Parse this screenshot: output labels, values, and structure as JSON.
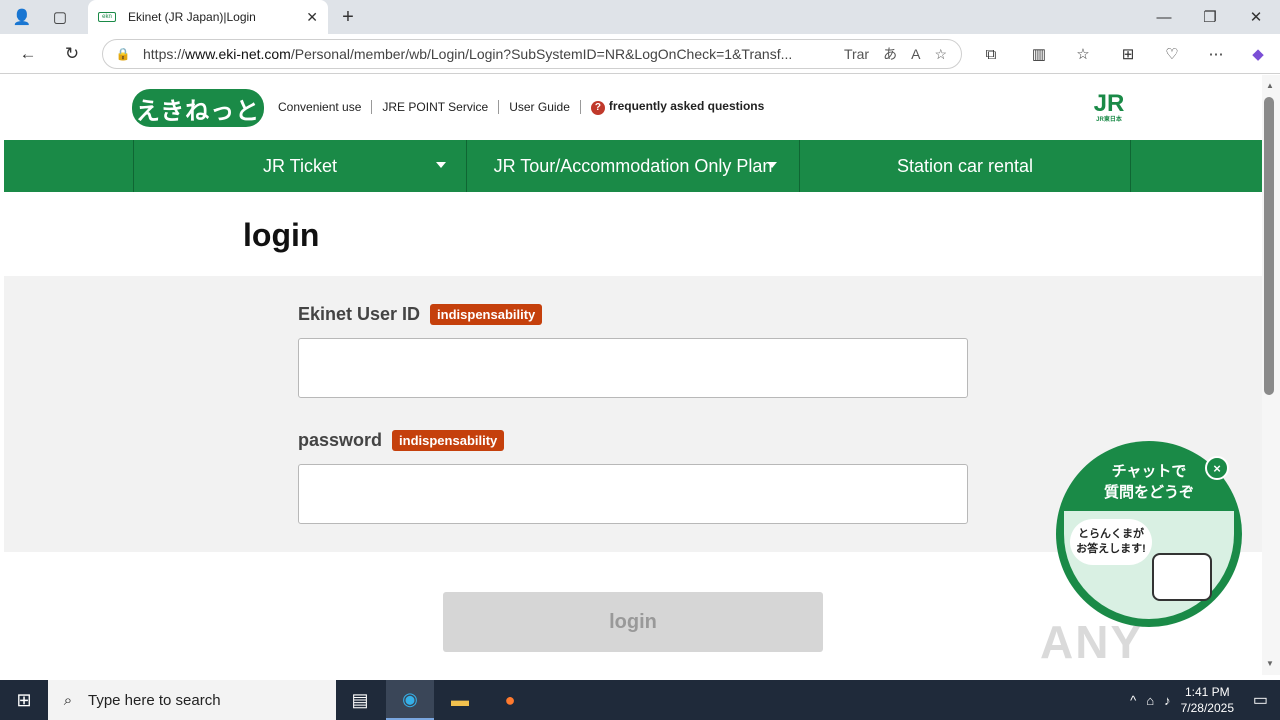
{
  "browser": {
    "tab_title": "Ekinet (JR Japan)|Login",
    "url_prefix": "https://",
    "url_host": "www.eki-net.com",
    "url_path": "/Personal/member/wb/Login/Login?SubSystemID=NR&LogOnCheck=1&Transf...",
    "translate_label": "Trar"
  },
  "header": {
    "logo_text": "えきねっと",
    "links": [
      "Convenient use",
      "JRE POINT Service",
      "User Guide"
    ],
    "faq": "frequently asked questions",
    "jr_logo": "JR",
    "jr_logo_sub": "JR東日本"
  },
  "nav": {
    "items": [
      "JR Ticket",
      "JR Tour/Accommodation Only Plan",
      "Station car rental"
    ]
  },
  "page": {
    "title": "login"
  },
  "form": {
    "user_id_label": "Ekinet User ID",
    "password_label": "password",
    "required_badge": "indispensability",
    "user_id_value": "",
    "password_value": "",
    "submit": "login"
  },
  "chat": {
    "title_line1": "チャットで",
    "title_line2": "質問をどうぞ",
    "bubble_line1": "とらんくまが",
    "bubble_line2": "お答えします!",
    "close": "×"
  },
  "watermark": "ANY RUN",
  "taskbar": {
    "search_placeholder": "Type here to search",
    "time": "1:41 PM",
    "date": "7/28/2025"
  }
}
